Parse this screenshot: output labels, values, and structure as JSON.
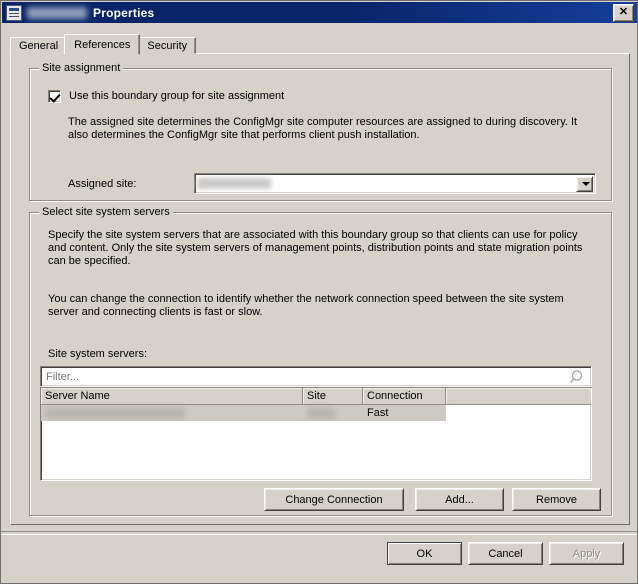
{
  "window": {
    "icon": "properties-sheet-icon",
    "title_prefix_redacted": true,
    "title": "Properties",
    "close_label": "✕"
  },
  "tabs": [
    {
      "label": "General",
      "selected": false
    },
    {
      "label": "References",
      "selected": true
    },
    {
      "label": "Security",
      "selected": false
    }
  ],
  "site_assignment": {
    "group_title": "Site assignment",
    "checkbox_label": "Use this boundary group for site assignment",
    "checkbox_checked": true,
    "description": "The assigned site determines the ConfigMgr site computer resources are assigned to during discovery. It also determines the ConfigMgr site that performs client push installation.",
    "assigned_site_label": "Assigned site:",
    "assigned_site_value": "",
    "assigned_site_redacted": true
  },
  "site_system_servers": {
    "group_title": "Select site system servers",
    "description_1": "Specify the site system servers that are associated with this boundary group so that clients can use for policy and content. Only the site system servers of management points, distribution points and state migration points can be specified.",
    "description_2": "You can change the connection to identify whether the network connection speed between the site system server and connecting clients is fast or slow.",
    "list_label": "Site system servers:",
    "filter_placeholder": "Filter...",
    "filter_value": "",
    "search_icon": "magnifier-icon",
    "columns": [
      "Server Name",
      "Site",
      "Connection",
      ""
    ],
    "rows": [
      {
        "server_name": "",
        "server_name_redacted": true,
        "site": "",
        "site_redacted": true,
        "connection": "Fast",
        "selected": true
      }
    ],
    "buttons": {
      "change_connection": "Change Connection",
      "add": "Add...",
      "remove": "Remove"
    }
  },
  "footer": {
    "ok": "OK",
    "cancel": "Cancel",
    "apply": "Apply",
    "apply_disabled": true
  },
  "colors": {
    "dialog_bg": "#d6d2ca",
    "titlebar": "#0a246a",
    "title_text": "#ffffff",
    "field_bg": "#ffffff",
    "selection_bg": "#cdcac3",
    "disabled_text": "#908c84"
  }
}
